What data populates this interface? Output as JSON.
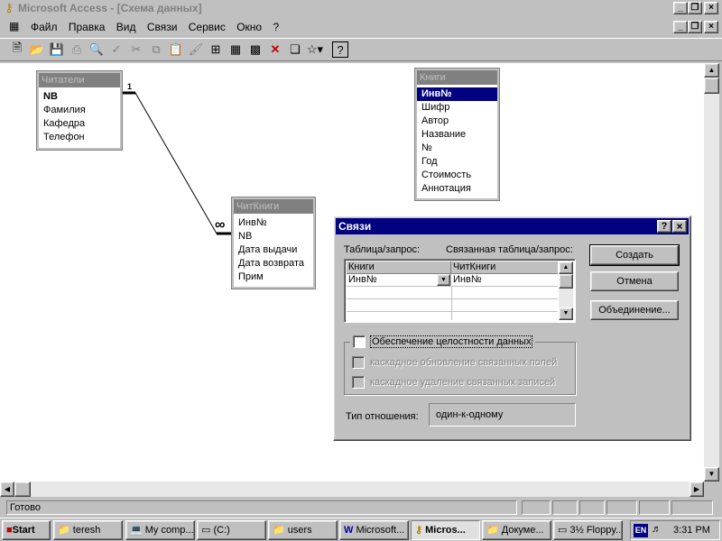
{
  "app": {
    "title": "Microsoft Access",
    "doc_title": "[Схема данных]"
  },
  "menu": {
    "items": [
      "Файл",
      "Правка",
      "Вид",
      "Связи",
      "Сервис",
      "Окно",
      "?"
    ]
  },
  "tables": {
    "readers": {
      "title": "Читатели",
      "fields": [
        "NB",
        "Фамилия",
        "Кафедра",
        "Телефон"
      ]
    },
    "books": {
      "title": "Книги",
      "fields": [
        "Инв№",
        "Шифр",
        "Автор",
        "Название",
        "№",
        "Год",
        "Стоимость",
        "Аннотация"
      ]
    },
    "chitknigi": {
      "title": "ЧитКниги",
      "fields": [
        "Инв№",
        "NB",
        "Дата выдачи",
        "Дата возврата",
        "Прим"
      ]
    }
  },
  "relation": {
    "one": "1",
    "many": "∞"
  },
  "dialog": {
    "title": "Связи",
    "help_btn": "?",
    "close_btn": "×",
    "table_label": "Таблица/запрос:",
    "related_label": "Связанная таблица/запрос:",
    "grid": {
      "col1_header": "Книги",
      "col2_header": "ЧитКниги",
      "row1_col1": "Инв№",
      "row1_col2": "Инв№"
    },
    "create_btn": "Создать",
    "cancel_btn": "Отмена",
    "join_btn": "Объединение...",
    "integrity_label": "Обеспечение целостности данных",
    "cascade_update_label": "каскадное обновление связанных полей",
    "cascade_delete_label": "каскадное удаление связанных записей",
    "relation_type_label": "Тип отношения:",
    "relation_type_value": "один-к-одному"
  },
  "status": {
    "text": "Готово"
  },
  "taskbar": {
    "start": "Start",
    "items": [
      "teresh",
      "My comp...",
      "(C:)",
      "users",
      "Microsoft...",
      "Micros...",
      "Докуме...",
      "3½ Floppy..."
    ],
    "lang": "EN",
    "clock": "3:31 PM"
  },
  "colors": {
    "titlebar": "#000080",
    "face": "#c0c0c0",
    "desktop": "#ffffff"
  }
}
